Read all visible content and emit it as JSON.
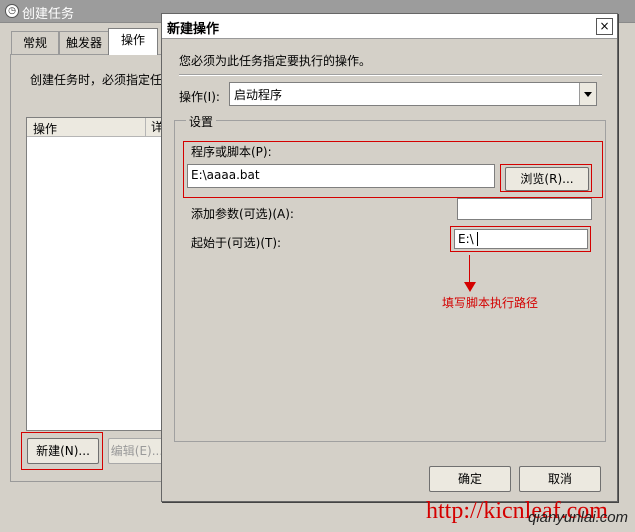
{
  "bg_window": {
    "title": "创建任务",
    "tabs": [
      "常规",
      "触发器",
      "操作"
    ],
    "instruction": "创建任务时，必须指定任",
    "list_columns": [
      "操作",
      "详"
    ],
    "new_button": "新建(N)...",
    "edit_button": "编辑(E)..."
  },
  "dialog": {
    "title": "新建操作",
    "close_glyph": "×",
    "instruction": "您必须为此任务指定要执行的操作。",
    "action_label": "操作(I):",
    "action_value": "启动程序",
    "settings_legend": "设置",
    "program_label": "程序或脚本(P):",
    "program_value": "E:\\aaaa.bat",
    "browse_button": "浏览(R)...",
    "args_label": "添加参数(可选)(A):",
    "args_value": "",
    "start_label": "起始于(可选)(T):",
    "start_value": "E:\\",
    "ok_button": "确定",
    "cancel_button": "取消"
  },
  "annotation": "填写脚本执行路径",
  "watermark": "http://kicnleaf.com",
  "watermark2": "qianyunlai.com",
  "colors": {
    "highlight": "#d40000",
    "dialog_bg": "#d4d0c8"
  }
}
